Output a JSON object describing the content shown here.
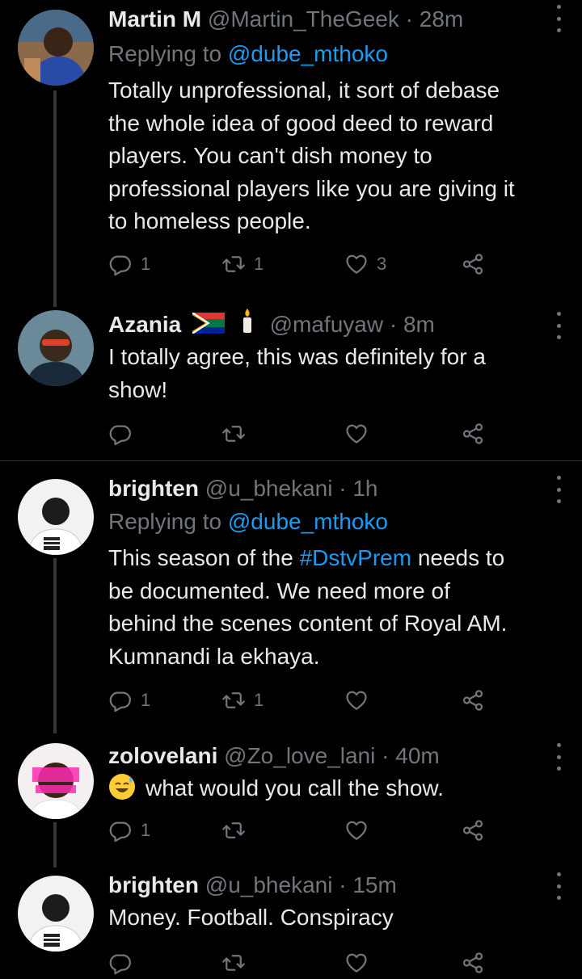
{
  "tweets": [
    {
      "display_name": "Martin M",
      "handle": "@Martin_TheGeek",
      "time": "28m",
      "replying_prefix": "Replying to",
      "replying_to": "@dube_mthoko",
      "lines": [
        "Totally unprofessional, it sort of debase",
        "the whole idea of good deed to reward",
        "players. You can't dish money to",
        "professional players like you are giving it",
        "to homeless people."
      ],
      "reply_count": "1",
      "retweet_count": "1",
      "like_count": "3"
    },
    {
      "display_name": "Azania",
      "handle": "@mafuyaw",
      "time": "8m",
      "lines": [
        "I totally agree, this was definitely for a",
        "show!"
      ],
      "reply_count": "",
      "retweet_count": "",
      "like_count": ""
    },
    {
      "display_name": "brighten",
      "handle": "@u_bhekani",
      "time": "1h",
      "replying_prefix": "Replying to",
      "replying_to": "@dube_mthoko",
      "line1_pre": "This season of the ",
      "hashtag": "#DstvPrem",
      "line1_post": " needs to",
      "lines": [
        "be documented. We need more of",
        "behind the scenes content of Royal AM.",
        "Kumnandi la ekhaya."
      ],
      "reply_count": "1",
      "retweet_count": "1",
      "like_count": ""
    },
    {
      "display_name": "zolovelani",
      "handle": "@Zo_love_lani",
      "time": "40m",
      "text": "what would you call the show.",
      "reply_count": "1",
      "retweet_count": "",
      "like_count": ""
    },
    {
      "display_name": "brighten",
      "handle": "@u_bhekani",
      "time": "15m",
      "text": "Money. Football. Conspiracy"
    }
  ],
  "separator": "·",
  "colors": {
    "background": "#000000",
    "text": "#e7e9ea",
    "muted": "#71767b",
    "link": "#1d9bf0"
  },
  "icons": [
    "reply-icon",
    "retweet-icon",
    "like-icon",
    "share-icon",
    "more-icon",
    "south-africa-flag-icon",
    "candle-icon",
    "sweat-smile-emoji-icon"
  ]
}
